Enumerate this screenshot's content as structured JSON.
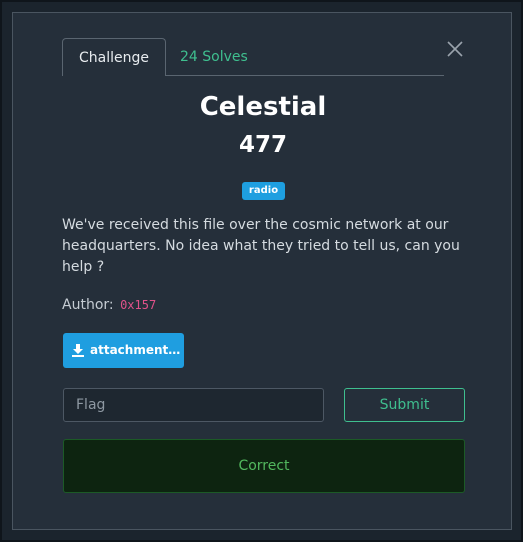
{
  "tabs": {
    "challenge_label": "Challenge",
    "solves_label": "24 Solves"
  },
  "challenge": {
    "name": "Celestial",
    "points": "477",
    "tag": "radio",
    "description": "We've received this file over the cosmic network at our headquarters. No idea what they tried to tell us, can you help ?",
    "author_label": "Author:",
    "author_name": "0x157"
  },
  "attachment": {
    "label": "attachment…",
    "icon": "download-icon"
  },
  "flag_form": {
    "placeholder": "Flag",
    "submit_label": "Submit"
  },
  "result": {
    "message": "Correct"
  },
  "icons": {
    "close": "close-icon",
    "download": "download-icon"
  },
  "colors": {
    "accent_green": "#3fbf8f",
    "tag_blue": "#1e9fe0",
    "author_pink": "#e0528a",
    "success_bg": "#0d2410",
    "success_text": "#52b85e"
  }
}
